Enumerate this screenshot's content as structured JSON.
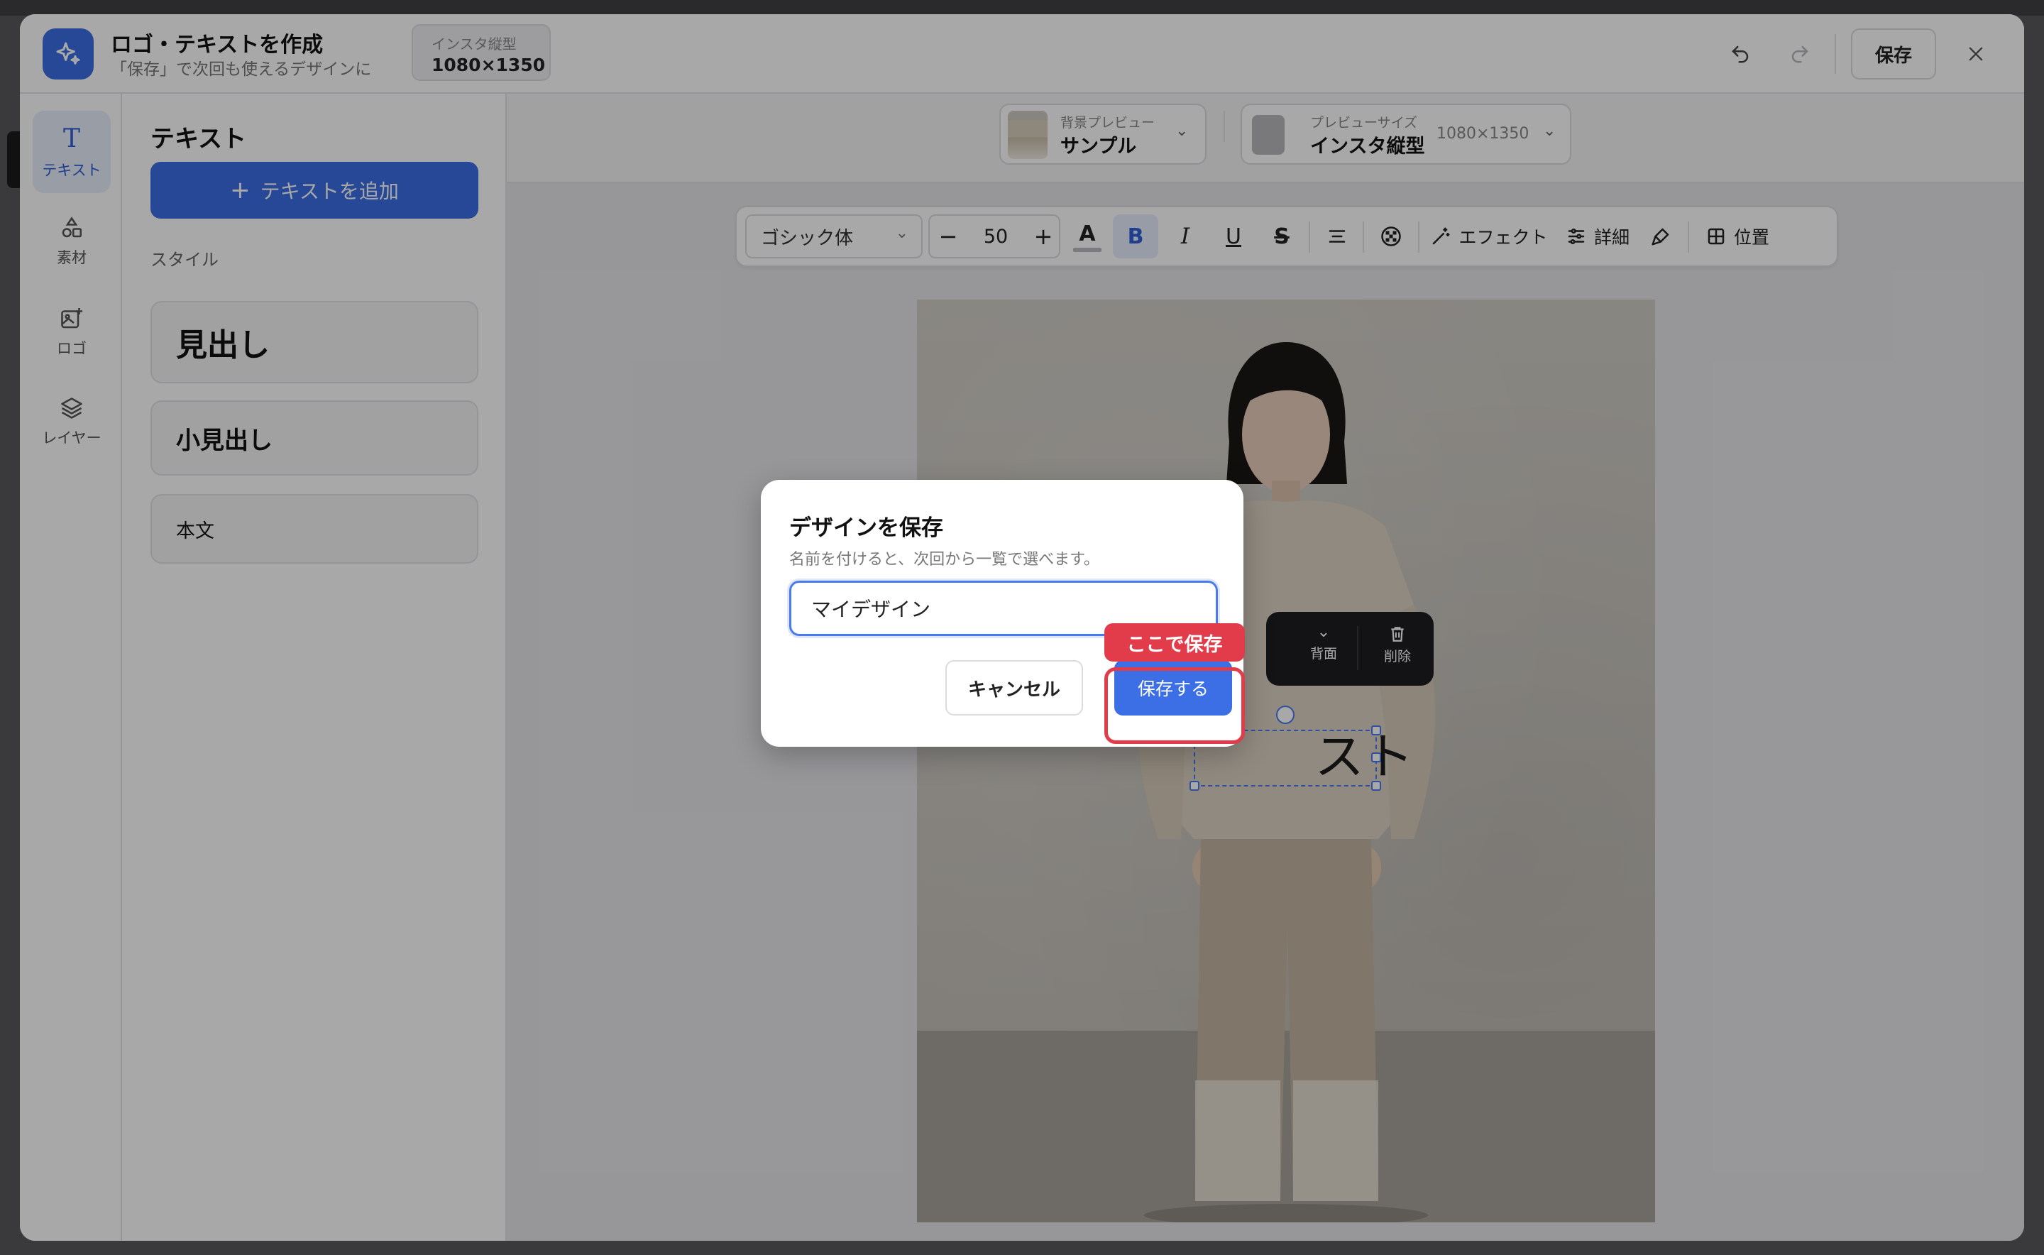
{
  "header": {
    "title": "ロゴ・テキストを作成",
    "subtitle": "「保存」で次回も使えるデザインに",
    "size_label": "インスタ縦型",
    "size_value": "1080×1350",
    "save_label": "保存"
  },
  "rail": [
    {
      "label": "テキスト",
      "icon": "text-icon",
      "active": true
    },
    {
      "label": "素材",
      "icon": "shapes-icon",
      "active": false
    },
    {
      "label": "ロゴ",
      "icon": "image-add-icon",
      "active": false
    },
    {
      "label": "レイヤー",
      "icon": "layers-icon",
      "active": false
    }
  ],
  "panel": {
    "title": "テキスト",
    "add_label": "テキストを追加",
    "style_section": "スタイル",
    "styles": [
      "見出し",
      "小見出し",
      "本文"
    ]
  },
  "preview": {
    "bg_label": "背景プレビュー",
    "bg_value": "サンプル",
    "size_label": "プレビューサイズ",
    "size_value": "インスタ縦型",
    "size_dims": "1080×1350"
  },
  "toolbar": {
    "font": "ゴシック体",
    "font_size": "50",
    "effect_label": "エフェクト",
    "detail_label": "詳細",
    "position_label": "位置"
  },
  "selection_toolbar": {
    "back_label": "背面",
    "delete_label": "削除"
  },
  "canvas_text": "テキスト",
  "dialog": {
    "title": "デザインを保存",
    "description": "名前を付けると、次回から一覧で選べます。",
    "input_value": "マイデザイン",
    "cancel_label": "キャンセル",
    "save_label": "保存する"
  },
  "callout": "ここで保存",
  "colors": {
    "accent": "#3c6ee6",
    "callout": "#e23b4a"
  }
}
